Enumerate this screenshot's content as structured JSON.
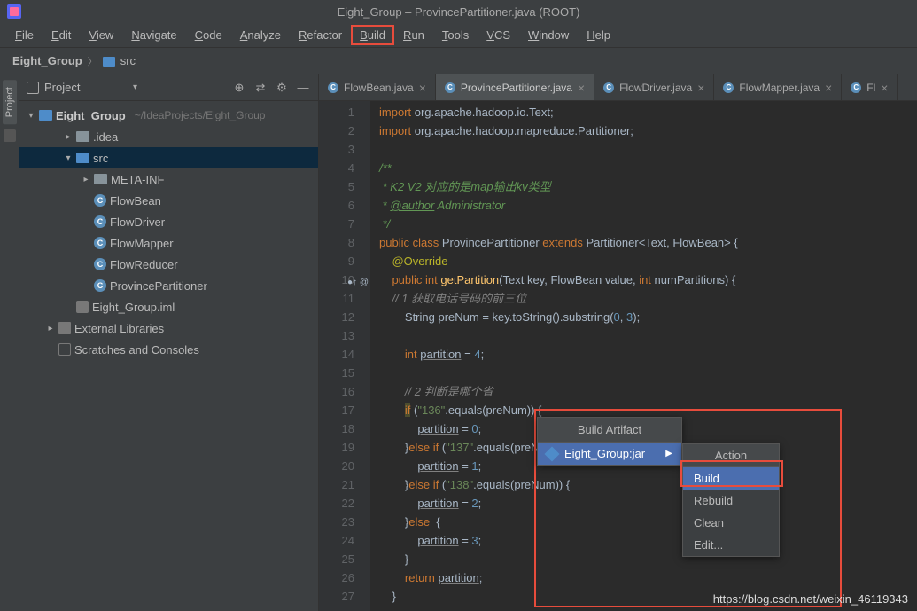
{
  "window_title": "Eight_Group – ProvincePartitioner.java (ROOT)",
  "menubar": [
    "File",
    "Edit",
    "View",
    "Navigate",
    "Code",
    "Analyze",
    "Refactor",
    "Build",
    "Run",
    "Tools",
    "VCS",
    "Window",
    "Help"
  ],
  "menubar_highlight_index": 7,
  "breadcrumb": {
    "project": "Eight_Group",
    "folder": "src"
  },
  "project_tool": {
    "label": "Project",
    "dropdown": "▾"
  },
  "tree": {
    "root": {
      "name": "Eight_Group",
      "path": "~/IdeaProjects/Eight_Group"
    },
    "children": [
      {
        "type": "folder",
        "name": ".idea",
        "depth": 1,
        "arrow": ">"
      },
      {
        "type": "folder-blue",
        "name": "src",
        "depth": 1,
        "arrow": "v",
        "selected": true
      },
      {
        "type": "folder",
        "name": "META-INF",
        "depth": 2,
        "arrow": ">"
      },
      {
        "type": "class",
        "name": "FlowBean",
        "depth": 2
      },
      {
        "type": "class",
        "name": "FlowDriver",
        "depth": 2
      },
      {
        "type": "class",
        "name": "FlowMapper",
        "depth": 2
      },
      {
        "type": "class",
        "name": "FlowReducer",
        "depth": 2
      },
      {
        "type": "class",
        "name": "ProvincePartitioner",
        "depth": 2
      },
      {
        "type": "iml",
        "name": "Eight_Group.iml",
        "depth": 1
      },
      {
        "type": "lib",
        "name": "External Libraries",
        "depth": 0,
        "arrow": ">"
      },
      {
        "type": "scratch",
        "name": "Scratches and Consoles",
        "depth": 0
      }
    ]
  },
  "tabs": [
    {
      "label": "FlowBean.java",
      "active": false
    },
    {
      "label": "ProvincePartitioner.java",
      "active": true
    },
    {
      "label": "FlowDriver.java",
      "active": false
    },
    {
      "label": "FlowMapper.java",
      "active": false
    },
    {
      "label": "Fl",
      "active": false
    }
  ],
  "code_lines": {
    "start": 1,
    "end": 27
  },
  "popup1": {
    "header": "Build Artifact",
    "item": "Eight_Group:jar"
  },
  "popup2": {
    "header": "Action",
    "items": [
      "Build",
      "Rebuild",
      "Clean",
      "Edit..."
    ],
    "selected_index": 0
  },
  "watermark": "https://blog.csdn.net/weixin_46119343",
  "sidebar_label": "Project"
}
